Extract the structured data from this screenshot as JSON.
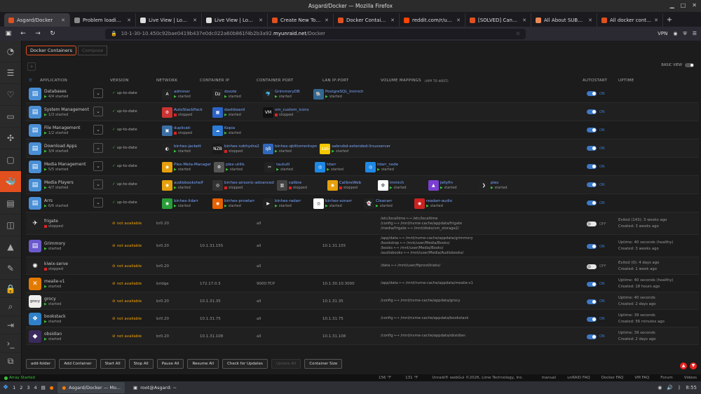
{
  "window": {
    "title": "Asgard/Docker — Mozilla Firefox"
  },
  "tabs": [
    {
      "label": "Asgard/Docker",
      "color": "#e2501f",
      "active": true
    },
    {
      "label": "Problem loading page",
      "color": "#888"
    },
    {
      "label": "Live View | Log File",
      "color": "#ddd"
    },
    {
      "label": "Live View | Log File",
      "color": "#ddd"
    },
    {
      "label": "Create New Topic",
      "color": "#e2501f"
    },
    {
      "label": "Docker Containers",
      "color": "#e2501f"
    },
    {
      "label": "reddit.com/r/unRAID",
      "color": "#ff4500"
    },
    {
      "label": "[SOLVED] Cannot access",
      "color": "#e2501f"
    },
    {
      "label": "All About SUBNETS",
      "color": "#e85"
    },
    {
      "label": "All docker containers",
      "color": "#e2501f"
    }
  ],
  "nav": {
    "url_prefix": "10-1-30-10.450c92bae0419b437e0dc022a60b861f4b2b3a92.",
    "url_domain": "myunraid.net",
    "url_path": "/Docker",
    "vpn": "VPN"
  },
  "sidebar": {
    "items": [
      "dashboard-icon",
      "list-icon",
      "heart-icon",
      "folder-icon",
      "puzzle-icon",
      "cube-icon",
      "docker-icon",
      "vm-icon",
      "layout-icon",
      "chart-icon",
      "tools-icon",
      "lock-icon",
      "search-icon",
      "exit-icon",
      "terminal-icon",
      "copy-icon"
    ]
  },
  "subtabs": {
    "containers": "Docker Containers",
    "compose": "Compose"
  },
  "basic_view": "BASIC VIEW",
  "headers": {
    "application": "APPLICATION",
    "version": "VERSION",
    "network": "NETWORK",
    "container_ip": "CONTAINER IP",
    "container_port": "CONTAINER PORT",
    "lan_ip_port": "LAN IP:PORT",
    "volume": "VOLUME MAPPINGS",
    "volume_sub": "(APP TO HOST)",
    "autostart": "AUTOSTART",
    "uptime": "UPTIME"
  },
  "folders": [
    {
      "name": "Databases",
      "state": "4/4 started",
      "color": "#4a8fd6",
      "version": "up-to-date",
      "items": [
        {
          "n": "adminer",
          "s": "started",
          "c": "#222",
          "t": "A",
          "st": "g"
        },
        {
          "n": "dozzle",
          "s": "started",
          "c": "#222",
          "t": "Dz",
          "st": "g"
        },
        {
          "n": "GrimmoryDB",
          "s": "started",
          "c": "#222",
          "t": "🐬",
          "st": "g"
        },
        {
          "n": "PostgreSQL_Immich",
          "s": "started",
          "c": "#336791",
          "t": "🐘",
          "st": "g"
        }
      ]
    },
    {
      "name": "System Management",
      "state": "1/3 started",
      "color": "#4a8fd6",
      "version": "up-to-date",
      "items": [
        {
          "n": "AutoStackPack",
          "s": "stopped",
          "c": "#c33",
          "t": "⚙",
          "st": "r"
        },
        {
          "n": "dashboard",
          "s": "started",
          "c": "#2b63c7",
          "t": "▦",
          "st": "g"
        },
        {
          "n": "vm_custom_icons",
          "s": "stopped",
          "c": "#111",
          "t": "VM",
          "st": "r"
        }
      ]
    },
    {
      "name": "File Management",
      "state": "1/2 started",
      "color": "#4a8fd6",
      "version": "up-to-date",
      "items": [
        {
          "n": "duplicati",
          "s": "stopped",
          "c": "#3a6ea5",
          "t": "▣",
          "st": "r"
        },
        {
          "n": "Kopia",
          "s": "started",
          "c": "#2c7ad6",
          "t": "☁",
          "st": "g"
        }
      ]
    },
    {
      "name": "Download Apps",
      "state": "3/4 started",
      "color": "#4a8fd6",
      "version": "up-to-date",
      "items": [
        {
          "n": "binhex-jackett",
          "s": "started",
          "c": "#222",
          "t": "◐",
          "st": "g"
        },
        {
          "n": "binhex-nzbhydra2",
          "s": "stopped",
          "c": "#1a1a1a",
          "t": "NZB",
          "st": "r"
        },
        {
          "n": "binhex-qbittorrentvpn",
          "s": "started",
          "c": "#2f67ba",
          "t": "qB",
          "st": "g"
        },
        {
          "n": "sabnzbd-extended-linuxserver",
          "s": "started",
          "c": "#f3c800",
          "t": "sab",
          "st": "g"
        }
      ]
    },
    {
      "name": "Media Management",
      "state": "5/5 started",
      "color": "#4a8fd6",
      "version": "up-to-date",
      "items": [
        {
          "n": "Plex-Meta-Manager",
          "s": "started",
          "c": "#e5a00d",
          "t": "◉",
          "st": "g"
        },
        {
          "n": "plex-utills",
          "s": "started",
          "c": "#555",
          "t": "⚙",
          "st": "g"
        },
        {
          "n": "tautulli",
          "s": "started",
          "c": "#222",
          "t": "✂",
          "st": "g"
        },
        {
          "n": "tdarr",
          "s": "started",
          "c": "#1e88e5",
          "t": "◎",
          "st": "g"
        },
        {
          "n": "tdarr_node",
          "s": "started",
          "c": "#1e88e5",
          "t": "◎",
          "st": "g"
        }
      ]
    },
    {
      "name": "Media Players",
      "state": "4/7 started",
      "color": "#4a8fd6",
      "version": "up-to-date",
      "items": [
        {
          "n": "audiobookshelf",
          "s": "started",
          "c": "#e5a00d",
          "t": "◉",
          "st": "g"
        },
        {
          "n": "binhex-airsonic-advanced",
          "s": "stopped",
          "c": "#333",
          "t": "◎",
          "st": "r"
        },
        {
          "n": "calibre",
          "s": "stopped",
          "c": "#444",
          "t": "▥",
          "st": "r"
        },
        {
          "n": "CalibreWeb",
          "s": "stopped",
          "c": "#e5a00d",
          "t": "◉",
          "st": "r"
        },
        {
          "n": "immich",
          "s": "started",
          "c": "#fff",
          "t": "✿",
          "st": "g"
        },
        {
          "n": "jellyfin",
          "s": "started",
          "c": "#7a3fd1",
          "t": "▲",
          "st": "g"
        },
        {
          "n": "plex",
          "s": "started",
          "c": "#222",
          "t": "❯",
          "st": "g"
        }
      ]
    },
    {
      "name": "Arrs",
      "state": "6/6 started",
      "color": "#4a8fd6",
      "version": "up-to-date",
      "items": [
        {
          "n": "binhex-lidarr",
          "s": "started",
          "c": "#2a9d3a",
          "t": "◉",
          "st": "g"
        },
        {
          "n": "binhex-prowlarr",
          "s": "started",
          "c": "#e66000",
          "t": "◉",
          "st": "g"
        },
        {
          "n": "binhex-radarr",
          "s": "started",
          "c": "#222",
          "t": "▶",
          "st": "g"
        },
        {
          "n": "binhex-sonarr",
          "s": "started",
          "c": "#fff",
          "t": "◎",
          "st": "g"
        },
        {
          "n": "Cleanarr",
          "s": "started",
          "c": "#222",
          "t": "👻",
          "st": "g"
        },
        {
          "n": "readarr-audio",
          "s": "started",
          "c": "#c22",
          "t": "◉",
          "st": "g"
        }
      ]
    }
  ],
  "containers": [
    {
      "name": "frigate",
      "state": "stopped",
      "icon_color": "#222",
      "icon": "✈",
      "version": "not available",
      "network": "br0.20",
      "ip": "",
      "port": "all",
      "lan": "",
      "vols": [
        "/etc/localtime ⟷ /etc/localtime",
        "/config ⟷ /mnt/nvme-cache/appdata/frigate",
        "/media/frigate ⟷ /mnt/disks/vm_storage2/"
      ],
      "auto": "OFF",
      "uptime": [
        "Exited (143): 3 weeks ago",
        "Created: 3 weeks ago"
      ]
    },
    {
      "name": "Grimmory",
      "state": "started",
      "icon_color": "#6a5acd",
      "icon": "▤",
      "version": "not available",
      "network": "br0.20",
      "ip": "10.1.31.155",
      "port": "all",
      "lan": "10.1.31.155",
      "vols": [
        "/app/data ⟷ /mnt/nvme-cache/appdata/grimmory",
        "/bookdrop ⟷ /mnt/user/Media/Books/",
        "/books ⟷ /mnt/user/Media/Books/",
        "/audiobooks ⟷ /mnt/user/Media/Audiobooks/"
      ],
      "auto": "ON",
      "uptime": [
        "Uptime: 40 seconds (healthy)",
        "Created: 3 weeks ago"
      ]
    },
    {
      "name": "kiwix-serve",
      "state": "stopped",
      "icon_color": "#222",
      "icon": "✺",
      "version": "not available",
      "network": "br0.20",
      "ip": "",
      "port": "all",
      "lan": "",
      "vols": [
        "/data ⟷ /mnt/user/ftproot/kiwix/"
      ],
      "auto": "OFF",
      "uptime": [
        "Exited (0): 4 days ago",
        "Created: 1 week ago"
      ]
    },
    {
      "name": "mealie-v1",
      "state": "started",
      "icon_color": "#e37a00",
      "icon": "✕",
      "version": "not available",
      "network": "bridge",
      "ip": "172.17.0.5",
      "port": "9000:TCP",
      "lan": "10.1.30.10:3000",
      "vols": [
        "/app/data ⟷ /mnt/nvme-cache/appdata/mealie-v1"
      ],
      "auto": "ON",
      "uptime": [
        "Uptime: 40 seconds (healthy)",
        "Created: 18 hours ago"
      ]
    },
    {
      "name": "grocy",
      "state": "started",
      "icon_color": "#eee",
      "icon": "grocy",
      "version": "not available",
      "network": "br0.20",
      "ip": "10.1.31.35",
      "port": "all",
      "lan": "10.1.31.35",
      "vols": [
        "/config ⟷ /mnt/nvme-cache/appdata/grocy"
      ],
      "auto": "ON",
      "uptime": [
        "Uptime: 40 seconds",
        "Created: 2 days ago"
      ]
    },
    {
      "name": "bookstack",
      "state": "started",
      "icon_color": "#2f80c8",
      "icon": "❖",
      "version": "not available",
      "network": "br0.20",
      "ip": "10.1.31.75",
      "port": "all",
      "lan": "10.1.31.75",
      "vols": [
        "/config ⟷ /mnt/nvme-cache/appdata/bookstack"
      ],
      "auto": "ON",
      "uptime": [
        "Uptime: 39 seconds",
        "Created: 56 minutes ago"
      ]
    },
    {
      "name": "obsidian",
      "state": "started",
      "icon_color": "#3a2a5e",
      "icon": "◆",
      "version": "not available",
      "network": "br0.20",
      "ip": "10.1.31.108",
      "port": "all",
      "lan": "10.1.31.108",
      "vols": [
        "/config ⟷ /mnt/nvme-cache/appdata/obsidian"
      ],
      "auto": "ON",
      "uptime": [
        "Uptime: 39 seconds",
        "Created: 2 days ago"
      ]
    }
  ],
  "buttons": {
    "add_folder": "add-folder",
    "add_container": "Add Container",
    "start_all": "Start All",
    "stop_all": "Stop All",
    "pause_all": "Pause All",
    "resume_all": "Resume All",
    "check_updates": "Check for Updates",
    "update_all": "Update All",
    "container_size": "Container Size"
  },
  "status": {
    "array": "Array Started",
    "temp1": "156 °F",
    "temp2": "131 °F",
    "copyright": "Unraid® webGui ©2026, Lime Technology, Inc.",
    "manual": "manual",
    "faq": "unRAID FAQ",
    "docker_faq": "Docker FAQ",
    "vm_faq": "VM FAQ",
    "forum": "Forum",
    "videos": "Videos"
  },
  "taskbar": {
    "workspaces": [
      "1",
      "2",
      "3",
      "4"
    ],
    "firefox": "Asgard/Docker — Mo...",
    "terminal": "root@Asgard: ~",
    "time": "8:55"
  }
}
